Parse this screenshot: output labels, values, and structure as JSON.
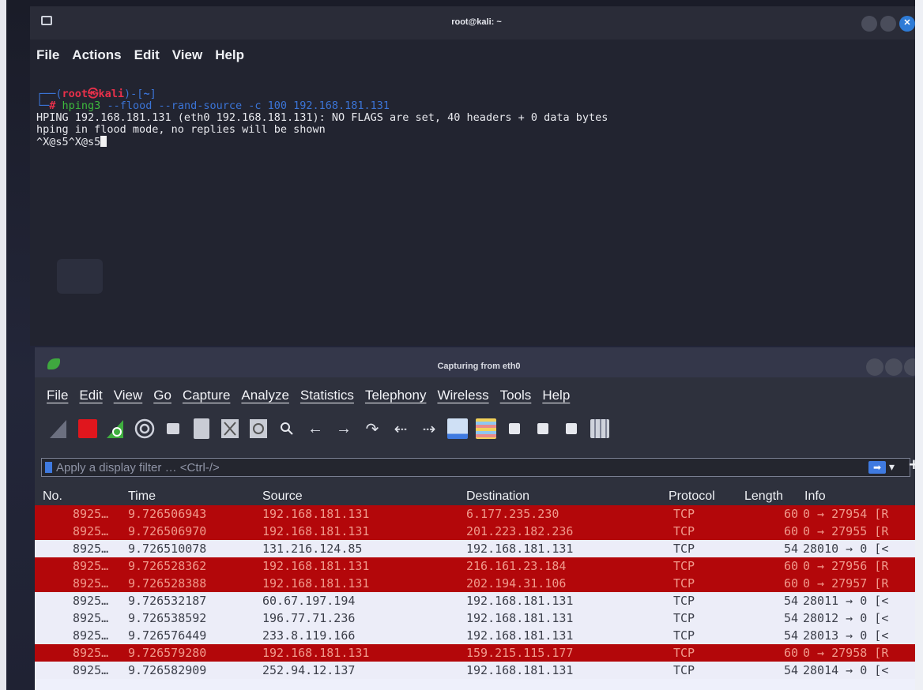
{
  "terminal": {
    "title": "root@kali: ~",
    "menu": [
      "File",
      "Actions",
      "Edit",
      "View",
      "Help"
    ],
    "prompt": {
      "top_prefix": "┌──(",
      "user_host": "root㉿kali",
      "top_mid": ")-[",
      "dir": "~",
      "top_suffix": "]",
      "bottom_prefix": "└─",
      "hash": "#",
      "cmd_name": " hping3",
      "cmd_args": " --flood --rand-source -c 100 192.168.181.131"
    },
    "output": [
      "HPING 192.168.181.131 (eth0 192.168.181.131): NO FLAGS are set, 40 headers + 0 data bytes",
      "hping in flood mode, no replies will be shown",
      "^X@s5^X@s5"
    ]
  },
  "wireshark": {
    "title": "Capturing from eth0",
    "menu": [
      "File",
      "Edit",
      "View",
      "Go",
      "Capture",
      "Analyze",
      "Statistics",
      "Telephony",
      "Wireless",
      "Tools",
      "Help"
    ],
    "toolbar_icons": [
      "shark-fin-start-icon",
      "stop-capture-icon",
      "restart-capture-icon",
      "capture-options-icon",
      "open-file-icon",
      "save-file-icon",
      "close-file-icon",
      "reload-file-icon",
      "find-packet-icon",
      "go-back-icon",
      "go-forward-icon",
      "go-to-packet-icon",
      "first-packet-icon",
      "last-packet-icon",
      "autoscroll-icon",
      "colorize-icon",
      "zoom-in-icon",
      "zoom-out-icon",
      "normal-size-icon",
      "resize-columns-icon"
    ],
    "filter": {
      "placeholder": "Apply a display filter … <Ctrl-/>"
    },
    "columns": [
      "No.",
      "Time",
      "Source",
      "Destination",
      "Protocol",
      "Length",
      "Info"
    ],
    "rows": [
      {
        "no": "8925…",
        "time": "9.726506943",
        "src": "192.168.181.131",
        "dst": "6.177.235.230",
        "proto": "TCP",
        "len": "60",
        "info": "0 → 27954 [R",
        "color": "red"
      },
      {
        "no": "8925…",
        "time": "9.726506970",
        "src": "192.168.181.131",
        "dst": "201.223.182.236",
        "proto": "TCP",
        "len": "60",
        "info": "0 → 27955 [R",
        "color": "red"
      },
      {
        "no": "8925…",
        "time": "9.726510078",
        "src": "131.216.124.85",
        "dst": "192.168.181.131",
        "proto": "TCP",
        "len": "54",
        "info": "28010 → 0 [<",
        "color": "white"
      },
      {
        "no": "8925…",
        "time": "9.726528362",
        "src": "192.168.181.131",
        "dst": "216.161.23.184",
        "proto": "TCP",
        "len": "60",
        "info": "0 → 27956 [R",
        "color": "red"
      },
      {
        "no": "8925…",
        "time": "9.726528388",
        "src": "192.168.181.131",
        "dst": "202.194.31.106",
        "proto": "TCP",
        "len": "60",
        "info": "0 → 27957 [R",
        "color": "red"
      },
      {
        "no": "8925…",
        "time": "9.726532187",
        "src": "60.67.197.194",
        "dst": "192.168.181.131",
        "proto": "TCP",
        "len": "54",
        "info": "28011 → 0 [<",
        "color": "white"
      },
      {
        "no": "8925…",
        "time": "9.726538592",
        "src": "196.77.71.236",
        "dst": "192.168.181.131",
        "proto": "TCP",
        "len": "54",
        "info": "28012 → 0 [<",
        "color": "white"
      },
      {
        "no": "8925…",
        "time": "9.726576449",
        "src": "233.8.119.166",
        "dst": "192.168.181.131",
        "proto": "TCP",
        "len": "54",
        "info": "28013 → 0 [<",
        "color": "white"
      },
      {
        "no": "8925…",
        "time": "9.726579280",
        "src": "192.168.181.131",
        "dst": "159.215.115.177",
        "proto": "TCP",
        "len": "60",
        "info": "0 → 27958 [R",
        "color": "red"
      },
      {
        "no": "8925…",
        "time": "9.726582909",
        "src": "252.94.12.137",
        "dst": "192.168.181.131",
        "proto": "TCP",
        "len": "54",
        "info": "28014 → 0 [<",
        "color": "white"
      }
    ]
  },
  "colors": {
    "red_row_bg": "#b3070a",
    "red_row_fg": "#f09a8c",
    "white_row_bg": "#ecedf8",
    "accent_blue": "#3f7ae0"
  }
}
